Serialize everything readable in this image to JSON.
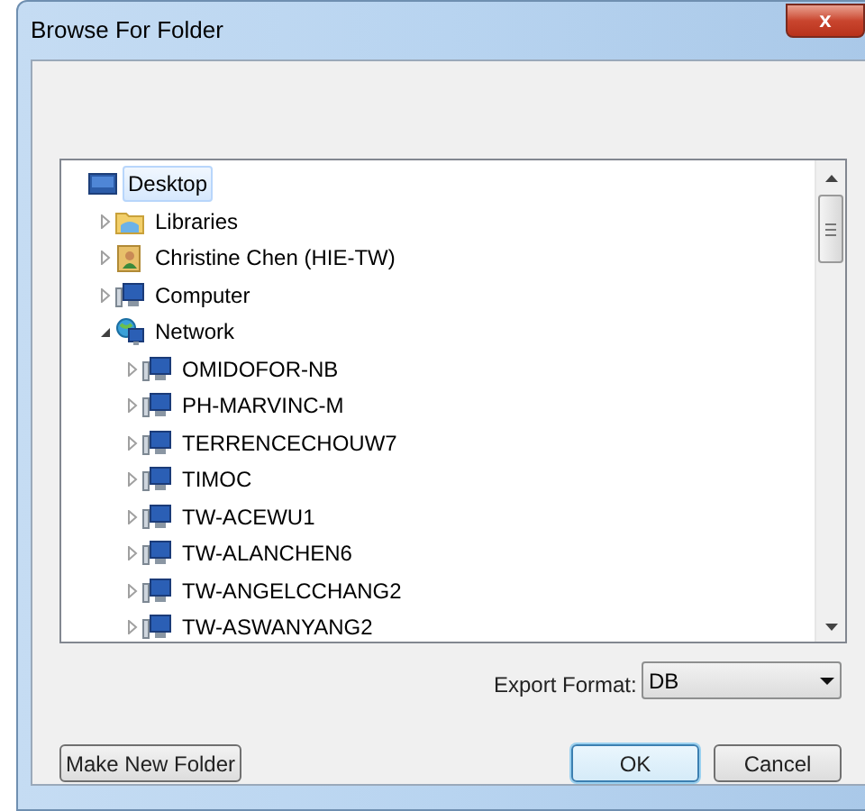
{
  "window": {
    "title": "Browse For Folder",
    "close": "x"
  },
  "tree": [
    {
      "label": "Desktop",
      "kind": "desktop",
      "selected": true,
      "children": [
        {
          "label": "Libraries",
          "kind": "libraries",
          "selected": false,
          "expanded": false
        },
        {
          "label": "Christine Chen (HIE-TW)",
          "kind": "user",
          "selected": false,
          "expanded": false
        },
        {
          "label": "Computer",
          "kind": "computer",
          "selected": false,
          "expanded": false
        },
        {
          "label": "Network",
          "kind": "network",
          "selected": false,
          "expanded": true,
          "children": [
            {
              "label": "OMIDOFOR-NB",
              "kind": "computer",
              "selected": false,
              "expanded": false
            },
            {
              "label": "PH-MARVINC-M",
              "kind": "computer",
              "selected": false,
              "expanded": false
            },
            {
              "label": "TERRENCECHOUW7",
              "kind": "computer",
              "selected": false,
              "expanded": false
            },
            {
              "label": "TIMOC",
              "kind": "computer",
              "selected": false,
              "expanded": false
            },
            {
              "label": "TW-ACEWU1",
              "kind": "computer",
              "selected": false,
              "expanded": false
            },
            {
              "label": "TW-ALANCHEN6",
              "kind": "computer",
              "selected": false,
              "expanded": false
            },
            {
              "label": "TW-ANGELCCHANG2",
              "kind": "computer",
              "selected": false,
              "expanded": false
            },
            {
              "label": "TW-ASWANYANG2",
              "kind": "computer",
              "selected": false,
              "expanded": false
            }
          ]
        }
      ]
    }
  ],
  "export_format": {
    "label": "Export Format:",
    "value": "DB"
  },
  "buttons": {
    "make_new_folder": "Make New Folder",
    "ok": "OK",
    "cancel": "Cancel"
  }
}
